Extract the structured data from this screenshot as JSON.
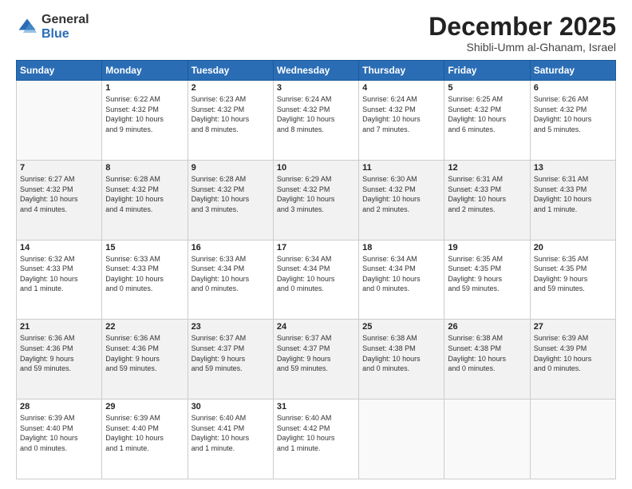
{
  "logo": {
    "general": "General",
    "blue": "Blue"
  },
  "header": {
    "title": "December 2025",
    "subtitle": "Shibli-Umm al-Ghanam, Israel"
  },
  "days_of_week": [
    "Sunday",
    "Monday",
    "Tuesday",
    "Wednesday",
    "Thursday",
    "Friday",
    "Saturday"
  ],
  "weeks": [
    [
      {
        "day": "",
        "info": ""
      },
      {
        "day": "1",
        "info": "Sunrise: 6:22 AM\nSunset: 4:32 PM\nDaylight: 10 hours\nand 9 minutes."
      },
      {
        "day": "2",
        "info": "Sunrise: 6:23 AM\nSunset: 4:32 PM\nDaylight: 10 hours\nand 8 minutes."
      },
      {
        "day": "3",
        "info": "Sunrise: 6:24 AM\nSunset: 4:32 PM\nDaylight: 10 hours\nand 8 minutes."
      },
      {
        "day": "4",
        "info": "Sunrise: 6:24 AM\nSunset: 4:32 PM\nDaylight: 10 hours\nand 7 minutes."
      },
      {
        "day": "5",
        "info": "Sunrise: 6:25 AM\nSunset: 4:32 PM\nDaylight: 10 hours\nand 6 minutes."
      },
      {
        "day": "6",
        "info": "Sunrise: 6:26 AM\nSunset: 4:32 PM\nDaylight: 10 hours\nand 5 minutes."
      }
    ],
    [
      {
        "day": "7",
        "info": "Sunrise: 6:27 AM\nSunset: 4:32 PM\nDaylight: 10 hours\nand 4 minutes."
      },
      {
        "day": "8",
        "info": "Sunrise: 6:28 AM\nSunset: 4:32 PM\nDaylight: 10 hours\nand 4 minutes."
      },
      {
        "day": "9",
        "info": "Sunrise: 6:28 AM\nSunset: 4:32 PM\nDaylight: 10 hours\nand 3 minutes."
      },
      {
        "day": "10",
        "info": "Sunrise: 6:29 AM\nSunset: 4:32 PM\nDaylight: 10 hours\nand 3 minutes."
      },
      {
        "day": "11",
        "info": "Sunrise: 6:30 AM\nSunset: 4:32 PM\nDaylight: 10 hours\nand 2 minutes."
      },
      {
        "day": "12",
        "info": "Sunrise: 6:31 AM\nSunset: 4:33 PM\nDaylight: 10 hours\nand 2 minutes."
      },
      {
        "day": "13",
        "info": "Sunrise: 6:31 AM\nSunset: 4:33 PM\nDaylight: 10 hours\nand 1 minute."
      }
    ],
    [
      {
        "day": "14",
        "info": "Sunrise: 6:32 AM\nSunset: 4:33 PM\nDaylight: 10 hours\nand 1 minute."
      },
      {
        "day": "15",
        "info": "Sunrise: 6:33 AM\nSunset: 4:33 PM\nDaylight: 10 hours\nand 0 minutes."
      },
      {
        "day": "16",
        "info": "Sunrise: 6:33 AM\nSunset: 4:34 PM\nDaylight: 10 hours\nand 0 minutes."
      },
      {
        "day": "17",
        "info": "Sunrise: 6:34 AM\nSunset: 4:34 PM\nDaylight: 10 hours\nand 0 minutes."
      },
      {
        "day": "18",
        "info": "Sunrise: 6:34 AM\nSunset: 4:34 PM\nDaylight: 10 hours\nand 0 minutes."
      },
      {
        "day": "19",
        "info": "Sunrise: 6:35 AM\nSunset: 4:35 PM\nDaylight: 9 hours\nand 59 minutes."
      },
      {
        "day": "20",
        "info": "Sunrise: 6:35 AM\nSunset: 4:35 PM\nDaylight: 9 hours\nand 59 minutes."
      }
    ],
    [
      {
        "day": "21",
        "info": "Sunrise: 6:36 AM\nSunset: 4:36 PM\nDaylight: 9 hours\nand 59 minutes."
      },
      {
        "day": "22",
        "info": "Sunrise: 6:36 AM\nSunset: 4:36 PM\nDaylight: 9 hours\nand 59 minutes."
      },
      {
        "day": "23",
        "info": "Sunrise: 6:37 AM\nSunset: 4:37 PM\nDaylight: 9 hours\nand 59 minutes."
      },
      {
        "day": "24",
        "info": "Sunrise: 6:37 AM\nSunset: 4:37 PM\nDaylight: 9 hours\nand 59 minutes."
      },
      {
        "day": "25",
        "info": "Sunrise: 6:38 AM\nSunset: 4:38 PM\nDaylight: 10 hours\nand 0 minutes."
      },
      {
        "day": "26",
        "info": "Sunrise: 6:38 AM\nSunset: 4:38 PM\nDaylight: 10 hours\nand 0 minutes."
      },
      {
        "day": "27",
        "info": "Sunrise: 6:39 AM\nSunset: 4:39 PM\nDaylight: 10 hours\nand 0 minutes."
      }
    ],
    [
      {
        "day": "28",
        "info": "Sunrise: 6:39 AM\nSunset: 4:40 PM\nDaylight: 10 hours\nand 0 minutes."
      },
      {
        "day": "29",
        "info": "Sunrise: 6:39 AM\nSunset: 4:40 PM\nDaylight: 10 hours\nand 1 minute."
      },
      {
        "day": "30",
        "info": "Sunrise: 6:40 AM\nSunset: 4:41 PM\nDaylight: 10 hours\nand 1 minute."
      },
      {
        "day": "31",
        "info": "Sunrise: 6:40 AM\nSunset: 4:42 PM\nDaylight: 10 hours\nand 1 minute."
      },
      {
        "day": "",
        "info": ""
      },
      {
        "day": "",
        "info": ""
      },
      {
        "day": "",
        "info": ""
      }
    ]
  ]
}
